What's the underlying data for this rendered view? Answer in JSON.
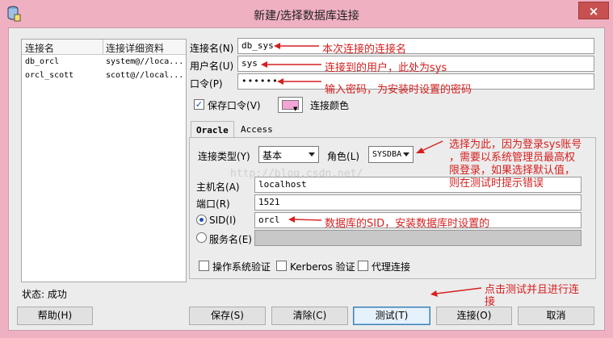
{
  "window": {
    "title": "新建/选择数据库连接",
    "close": "×"
  },
  "connections": {
    "headers": [
      "连接名",
      "连接详细资料"
    ],
    "rows": [
      {
        "name": "db_orcl",
        "detail": "system@//loca..."
      },
      {
        "name": "orcl_scott",
        "detail": "scott@//local..."
      }
    ]
  },
  "status": "状态: 成功",
  "form": {
    "conn_name_label": "连接名",
    "conn_name_key": "(N)",
    "conn_name_value": "db_sys",
    "user_label": "用户名",
    "user_key": "(U)",
    "user_value": "sys",
    "pass_label": "口令",
    "pass_key": "(P)",
    "pass_value": "••••••",
    "save_pass_label": "保存口令",
    "save_pass_key": "(V)",
    "save_pass_checked": "✓",
    "conn_color_label": "连接颜色"
  },
  "tabs": [
    "Oracle",
    "Access"
  ],
  "oracle": {
    "conn_type_label": "连接类型",
    "conn_type_key": "(Y)",
    "conn_type_value": "基本",
    "role_label": "角色",
    "role_key": "(L)",
    "role_value": "SYSDBA",
    "host_label": "主机名",
    "host_key": "(A)",
    "host_value": "localhost",
    "port_label": "端口",
    "port_key": "(R)",
    "port_value": "1521",
    "sid_label": "SID",
    "sid_key": "(I)",
    "sid_value": "orcl",
    "service_label": "服务名",
    "service_key": "(E)",
    "os_auth_label": "操作系统验证",
    "kerberos_label": "Kerberos 验证",
    "proxy_label": "代理连接"
  },
  "buttons": {
    "help": "帮助(H)",
    "save": "保存(S)",
    "clear": "清除(C)",
    "test": "测试(T)",
    "connect": "连接(O)",
    "cancel": "取消"
  },
  "watermark": "http://blog.csdn.net/",
  "annotations": {
    "conn_name": "本次连接的连接名",
    "user": "连接到的用户，此处为sys",
    "password": "输入密码，为安装时设置的密码",
    "role_line1": "选择为此，因为登录sys账号",
    "role_line2": "，需要以系统管理员最高权",
    "role_line3": "限登录，如果选择默认值，",
    "role_line4": "则在测试时提示错误",
    "sid": "数据库的SID，安装数据库时设置的",
    "test_line1": "点击测试并且进行连",
    "test_line2": "接"
  },
  "colors": {
    "frame": "#efb0c2",
    "annotation": "#d62020",
    "conn_color": "#f3a5d6"
  }
}
